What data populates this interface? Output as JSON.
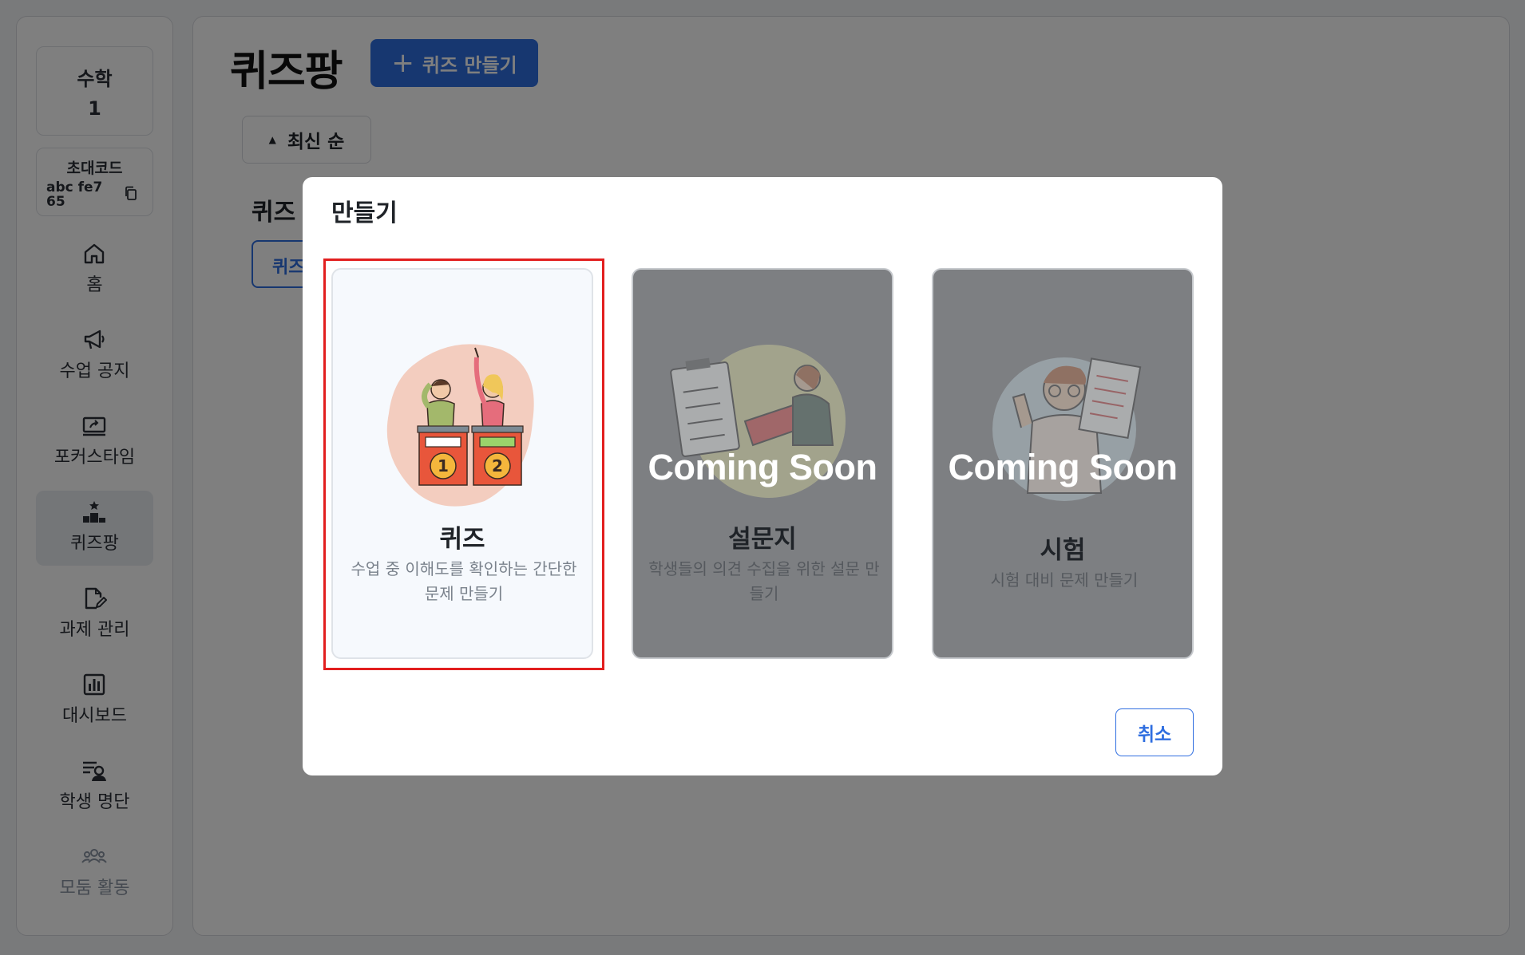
{
  "sidebar": {
    "class_subject": "수학",
    "class_number": "1",
    "invite_title": "초대코드",
    "invite_code": "abc fe765",
    "items": [
      {
        "label": "홈",
        "icon": "home-icon"
      },
      {
        "label": "수업 공지",
        "icon": "megaphone-icon"
      },
      {
        "label": "포커스타임",
        "icon": "monitor-icon"
      },
      {
        "label": "퀴즈팡",
        "icon": "podium-star-icon"
      },
      {
        "label": "과제 관리",
        "icon": "document-edit-icon"
      },
      {
        "label": "대시보드",
        "icon": "bar-chart-icon"
      },
      {
        "label": "학생 명단",
        "icon": "student-list-icon"
      },
      {
        "label": "모둠 활동",
        "icon": "group-icon"
      }
    ],
    "active_item": "퀴즈팡"
  },
  "main": {
    "title": "퀴즈팡",
    "create_button": "퀴즈 만들기",
    "sort_label": "최신 순",
    "section_title": "퀴즈",
    "chip_label": "퀴즈"
  },
  "modal": {
    "title": "만들기",
    "cards": [
      {
        "name": "퀴즈",
        "desc": "수업 중 이해도를 확인하는 간단한 문제 만들기",
        "enabled": true,
        "badge": ""
      },
      {
        "name": "설문지",
        "desc": "학생들의 의견 수집을 위한 설문 만들기",
        "enabled": false,
        "badge": "Coming Soon"
      },
      {
        "name": "시험",
        "desc": "시험 대비 문제 만들기",
        "enabled": false,
        "badge": "Coming Soon"
      }
    ],
    "cancel_label": "취소"
  },
  "colors": {
    "primary": "#2f6ee0",
    "highlight": "#e21f1f",
    "overlay": "rgba(0,0,0,0.5)"
  }
}
